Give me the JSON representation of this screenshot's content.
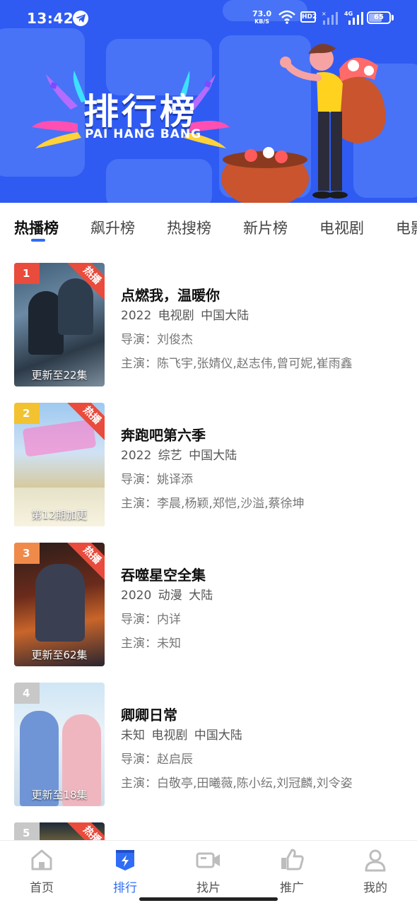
{
  "status_bar": {
    "time": "13:42",
    "net_speed": "73.0",
    "net_unit": "KB/S",
    "hd_label": "HD2",
    "network_label": "4G",
    "battery": "65",
    "battery_level": 0.65
  },
  "banner": {
    "title": "排行榜",
    "subtitle": "PAI HANG BANG"
  },
  "tabs": [
    {
      "label": "热播榜",
      "active": true
    },
    {
      "label": "飙升榜",
      "active": false
    },
    {
      "label": "热搜榜",
      "active": false
    },
    {
      "label": "新片榜",
      "active": false
    },
    {
      "label": "电视剧",
      "active": false
    },
    {
      "label": "电影",
      "active": false
    }
  ],
  "list": [
    {
      "rank": "1",
      "badge": "热播",
      "update": "更新至22集",
      "title": "点燃我，温暖你",
      "meta": "2022  电视剧  中国大陆",
      "director": "导演：刘俊杰",
      "actors": "主演：陈飞宇,张婧仪,赵志伟,曾可妮,崔雨鑫",
      "rank_color": "#e94b3c"
    },
    {
      "rank": "2",
      "badge": "热播",
      "update": "第12期加更",
      "title": "奔跑吧第六季",
      "meta": "2022  综艺  中国大陆",
      "director": "导演：姚译添",
      "actors": "主演：李晨,杨颖,郑恺,沙溢,蔡徐坤",
      "rank_color": "#f2c230"
    },
    {
      "rank": "3",
      "badge": "热播",
      "update": "更新至62集",
      "title": "吞噬星空全集",
      "meta": "2020  动漫  大陆",
      "director": "导演：内详",
      "actors": "主演：未知",
      "rank_color": "#f08a4b"
    },
    {
      "rank": "4",
      "badge": "",
      "update": "更新至18集",
      "title": "卿卿日常",
      "meta": "未知  电视剧  中国大陆",
      "director": "导演：赵启辰",
      "actors": "主演：白敬亭,田曦薇,陈小纭,刘冠麟,刘令姿",
      "rank_color": "#c8c8c8"
    },
    {
      "rank": "5",
      "badge": "热播",
      "update": "",
      "title": "",
      "meta": "",
      "director": "",
      "actors": "",
      "rank_color": "#c8c8c8"
    }
  ],
  "bottom_nav": [
    {
      "label": "首页",
      "icon": "home-icon",
      "active": false
    },
    {
      "label": "排行",
      "icon": "ranking-icon",
      "active": true
    },
    {
      "label": "找片",
      "icon": "video-camera-icon",
      "active": false
    },
    {
      "label": "推广",
      "icon": "thumbs-up-icon",
      "active": false
    },
    {
      "label": "我的",
      "icon": "user-icon",
      "active": false
    }
  ],
  "colors": {
    "banner_bg": "#2f5bf2",
    "accent": "#2f6df6",
    "hot_badge": "#e94b3c"
  }
}
